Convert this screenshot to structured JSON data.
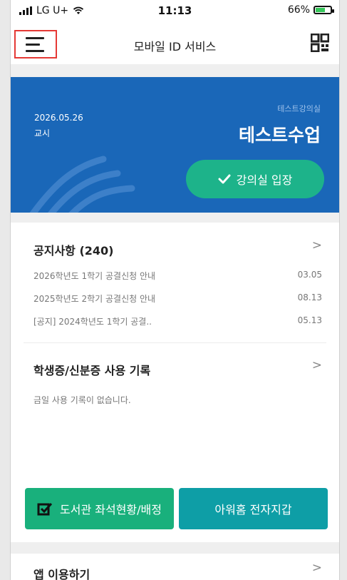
{
  "status_bar": {
    "carrier": "LG U+",
    "time": "11:13",
    "battery": "66%",
    "battery_level": 0.66
  },
  "header": {
    "title": "모바일 ID 서비스",
    "menu_icon": "hamburger-icon",
    "qr_icon": "qr-code-icon"
  },
  "class_card": {
    "date": "2026.05.26",
    "period": "교시",
    "room": "테스트강의실",
    "course": "테스트수업",
    "enter_label": "강의실 입장"
  },
  "notice": {
    "title": "공지사항 (240)",
    "items": [
      {
        "text": "2026학년도 1학기 공결신청 안내",
        "date": "03.05"
      },
      {
        "text": "2025학년도 2학기 공결신청 안내",
        "date": "08.13"
      },
      {
        "text": "[공지] 2024학년도 1학기 공결..",
        "date": "05.13"
      }
    ]
  },
  "usage": {
    "title": "학생증/신분증 사용 기록",
    "empty_text": "금일 사용 기록이 없습니다."
  },
  "buttons": {
    "library": "도서관 좌석현황/배정",
    "wallet": "아워홈 전자지갑"
  },
  "app_guide": {
    "title": "앱 이용하기"
  },
  "colors": {
    "card_blue": "#1a67b8",
    "enter_green": "#1db38a",
    "library_green": "#19b07c",
    "wallet_teal": "#0e9ea6",
    "highlight_red": "#e53935"
  }
}
